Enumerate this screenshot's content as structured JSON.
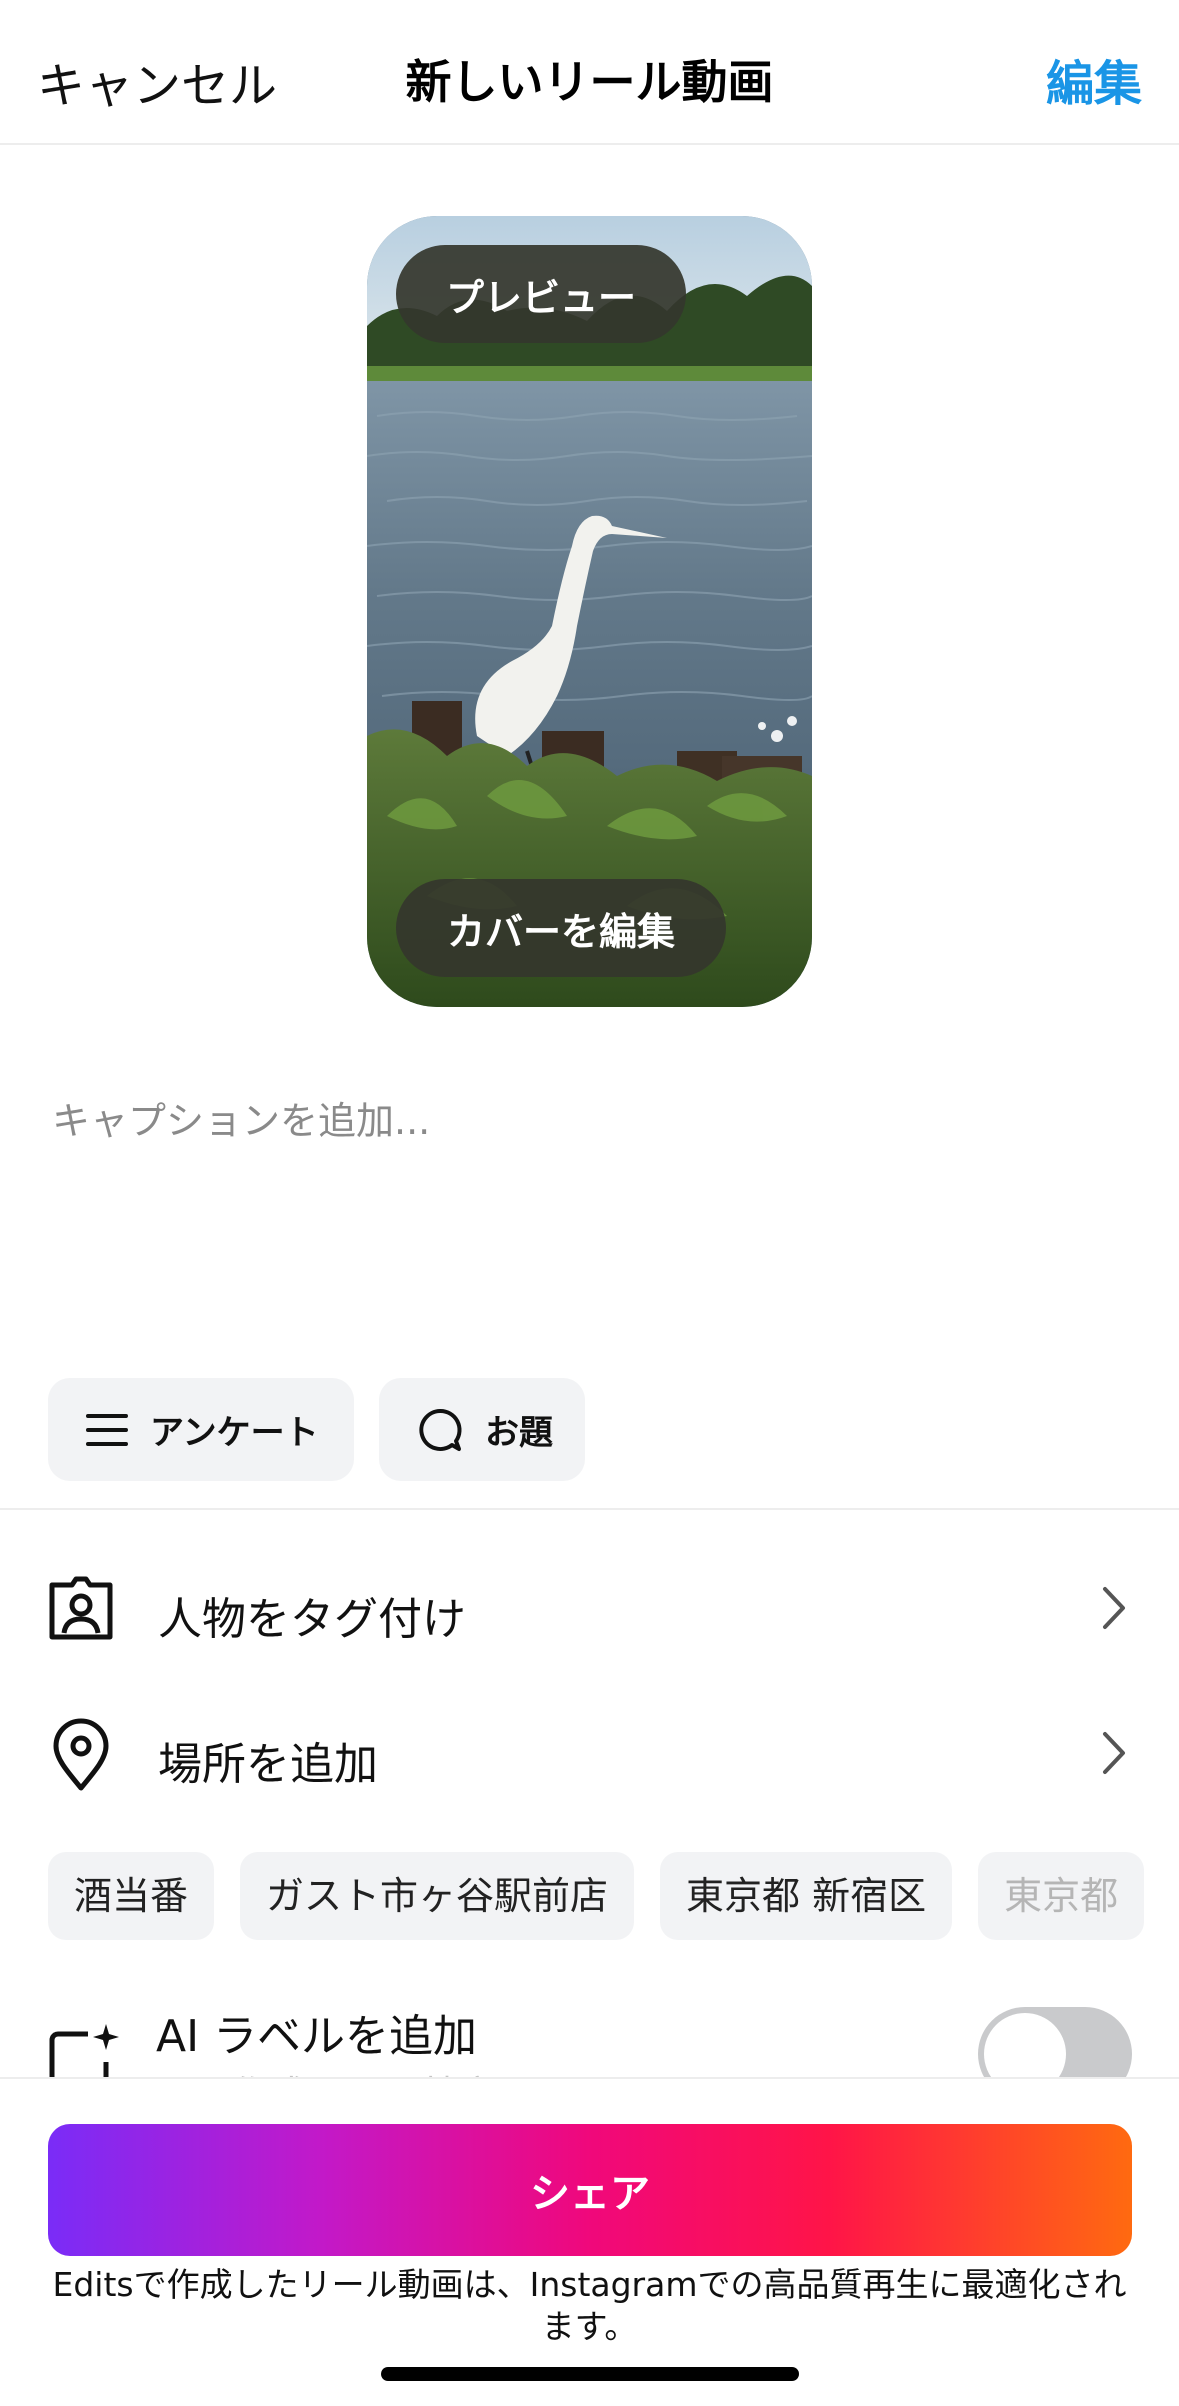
{
  "header": {
    "cancel_label": "キャンセル",
    "title": "新しいリール動画",
    "edit_label": "編集"
  },
  "preview": {
    "preview_label": "プレビュー",
    "edit_cover_label": "カバーを編集"
  },
  "caption": {
    "placeholder": "キャプションを追加..."
  },
  "quick_actions": {
    "poll_label": "アンケート",
    "topic_label": "お題"
  },
  "rows": {
    "tag_people_label": "人物をタグ付け",
    "add_location_label": "場所を追加"
  },
  "location_suggestions": [
    "酒当番",
    "ガスト市ヶ谷駅前店",
    "東京都 新宿区",
    "東京都"
  ],
  "ai_label": {
    "title": "AI ラベルを追加",
    "subtitle": "AIで作成された特定のリアルなコンテンツ",
    "toggle_on": false
  },
  "share": {
    "button_label": "シェア",
    "footnote": "Editsで作成したリール動画は、Instagramでの高品質再生に最適化されます。"
  },
  "colors": {
    "accent_blue": "#1a95e6",
    "share_gradient_start": "#7a2cf7",
    "share_gradient_end": "#ff6a10"
  }
}
